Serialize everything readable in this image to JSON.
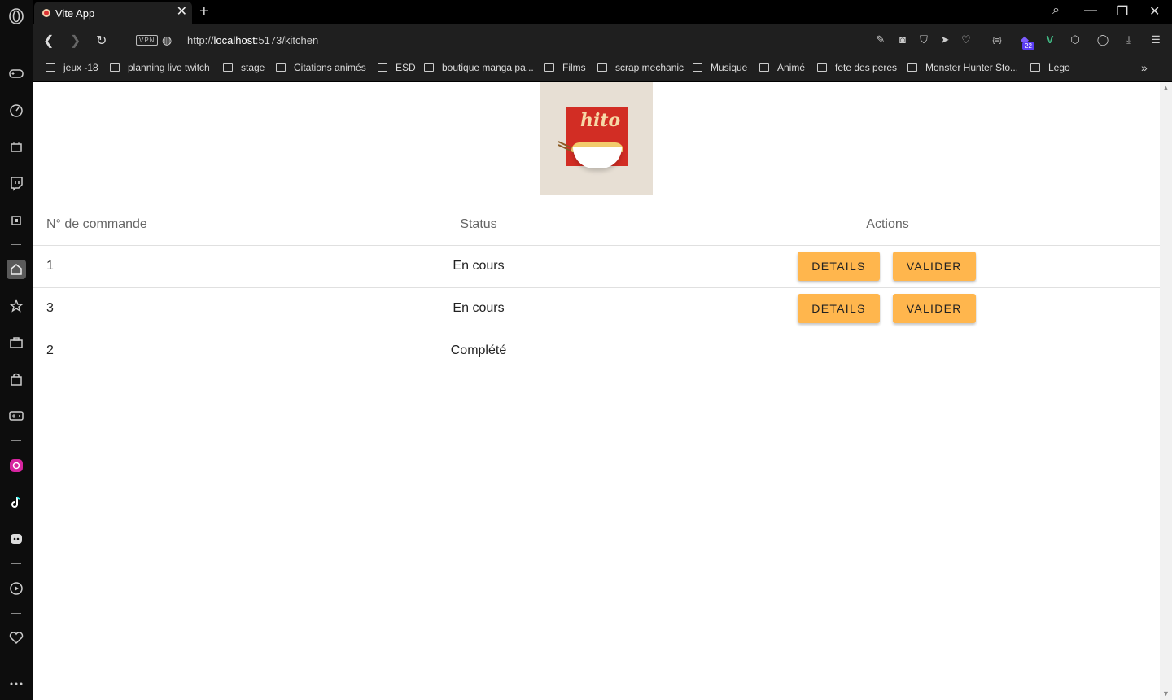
{
  "browser": {
    "tab_title": "Vite App",
    "url_prefix": "http://",
    "url_host": "localhost",
    "url_rest": ":5173/kitchen",
    "vpn_label": "VPN",
    "ext_badge": "22"
  },
  "bookmarks": [
    "jeux -18",
    "planning live twitch",
    "stage",
    "Citations animés",
    "ESD",
    "boutique manga pa...",
    "Films",
    "scrap mechanic",
    "Musique",
    "Animé",
    "fete des peres",
    "Monster Hunter Sto...",
    "Lego"
  ],
  "logo": {
    "text": "hito"
  },
  "table": {
    "headers": {
      "order": "N° de commande",
      "status": "Status",
      "actions": "Actions"
    },
    "rows": [
      {
        "order": "1",
        "status": "En cours",
        "details": "DETAILS",
        "validate": "VALIDER"
      },
      {
        "order": "3",
        "status": "En cours",
        "details": "DETAILS",
        "validate": "VALIDER"
      },
      {
        "order": "2",
        "status": "Complété"
      }
    ]
  },
  "colors": {
    "button": "#ffb64d",
    "logo_red": "#d22d24"
  }
}
